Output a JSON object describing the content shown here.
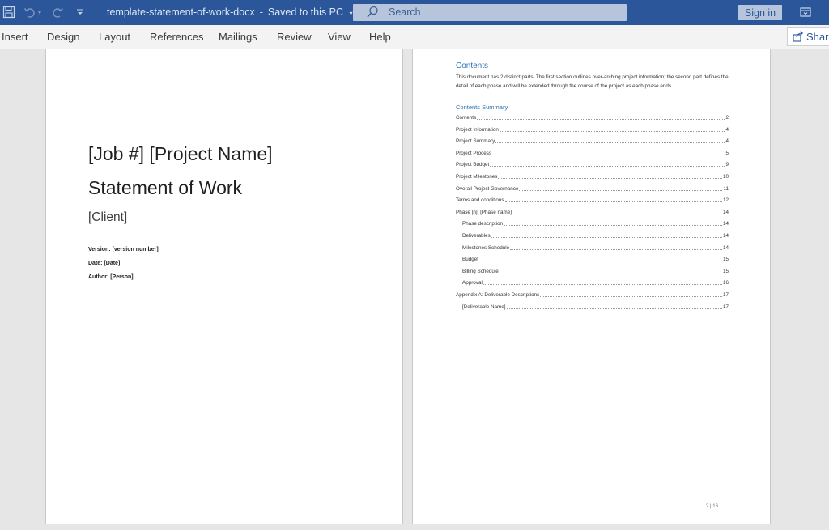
{
  "titlebar": {
    "doc_name": "template-statement-of-work-docx",
    "separator": "-",
    "save_status": "Saved to this PC",
    "search_placeholder": "Search",
    "signin_label": "Sign in",
    "icons": [
      "save-icon",
      "undo-icon",
      "redo-icon",
      "customize-quick-access-icon",
      "search-icon",
      "ribbon-display-options-icon"
    ],
    "bar_color": "#2b579a"
  },
  "ribbon": {
    "tabs": [
      "Insert",
      "Design",
      "Layout",
      "References",
      "Mailings",
      "Review",
      "View",
      "Help"
    ],
    "share_label": "Share"
  },
  "page1": {
    "title_line1": "[Job #] [Project Name]",
    "title_line2": "Statement of Work",
    "client": "[Client]",
    "version": "Version: [version number]",
    "date": "Date: [Date]",
    "author": "Author: [Person]"
  },
  "page2": {
    "contents_heading": "Contents",
    "intro": "This document has 2 distinct parts. The first section outlines over-arching project information; the second part defines the detail of each phase and will be extended through the course of the project as each phase ends.",
    "summary_heading": "Contents Summary",
    "toc": [
      {
        "label": "Contents",
        "page": "2",
        "indent": false
      },
      {
        "label": "Project Information",
        "page": "4",
        "indent": false
      },
      {
        "label": "Project Summary",
        "page": "4",
        "indent": false
      },
      {
        "label": "Project Process",
        "page": "5",
        "indent": false
      },
      {
        "label": "Project Budget",
        "page": "9",
        "indent": false
      },
      {
        "label": "Project Milestones",
        "page": "10",
        "indent": false
      },
      {
        "label": "Overall Project Governance",
        "page": "11",
        "indent": false
      },
      {
        "label": "Terms and conditions",
        "page": "12",
        "indent": false
      },
      {
        "label": "Phase [n]:  [Phase name]",
        "page": "14",
        "indent": false
      },
      {
        "label": "Phase description",
        "page": "14",
        "indent": true
      },
      {
        "label": "Deliverables",
        "page": "14",
        "indent": true
      },
      {
        "label": "Milestones Schedule",
        "page": "14",
        "indent": true
      },
      {
        "label": "Budget",
        "page": "15",
        "indent": true
      },
      {
        "label": "Billing Schedule",
        "page": "15",
        "indent": true
      },
      {
        "label": "Approval",
        "page": "16",
        "indent": true
      },
      {
        "label": "Appendix A: Deliverable Descriptions",
        "page": "17",
        "indent": false
      },
      {
        "label": "[Deliverable Name]",
        "page": "17",
        "indent": true
      }
    ],
    "page_number": "2 | 16",
    "heading_color": "#2e74b5"
  }
}
